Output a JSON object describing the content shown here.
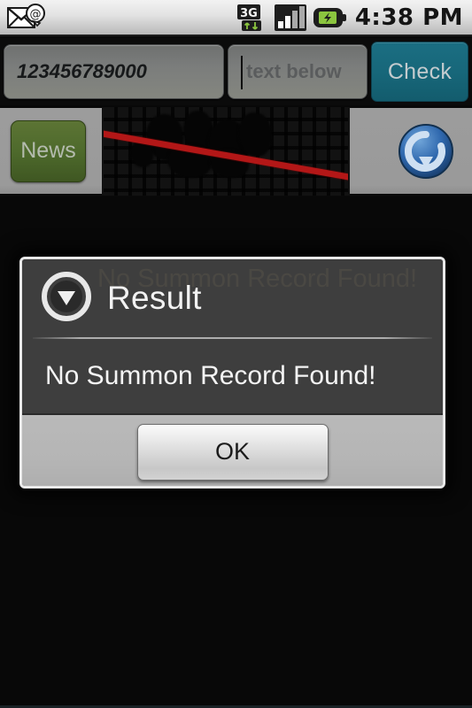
{
  "status_bar": {
    "notification_icon": "mail-at-icon",
    "network_icon": "3g-data-icon",
    "network_label": "3G",
    "signal_icon": "signal-bars-icon",
    "battery_icon": "battery-charging-icon",
    "clock": "4:38 PM"
  },
  "input_row": {
    "number_field": {
      "value": "123456789000",
      "placeholder": ""
    },
    "captcha_field": {
      "value": "",
      "placeholder": "text below"
    },
    "check_button_label": "Check"
  },
  "captcha_row": {
    "news_button_label": "News",
    "captcha_image_name": "captcha-image",
    "refresh_icon": "refresh-icon"
  },
  "dialog": {
    "icon": "alert-down-arrow-icon",
    "title": "Result",
    "ghost_title_text": "No Summon Record Found!",
    "message": "No Summon Record Found!",
    "ok_button_label": "OK"
  },
  "colors": {
    "check_button": "#17677a",
    "news_button": "#4e6a2c",
    "captcha_strike": "#b31717",
    "refresh_icon": "#2d5f9e",
    "dialog_body": "#3e3e3e",
    "dialog_footer": "#b5b5b5",
    "page_background": "#080808"
  }
}
